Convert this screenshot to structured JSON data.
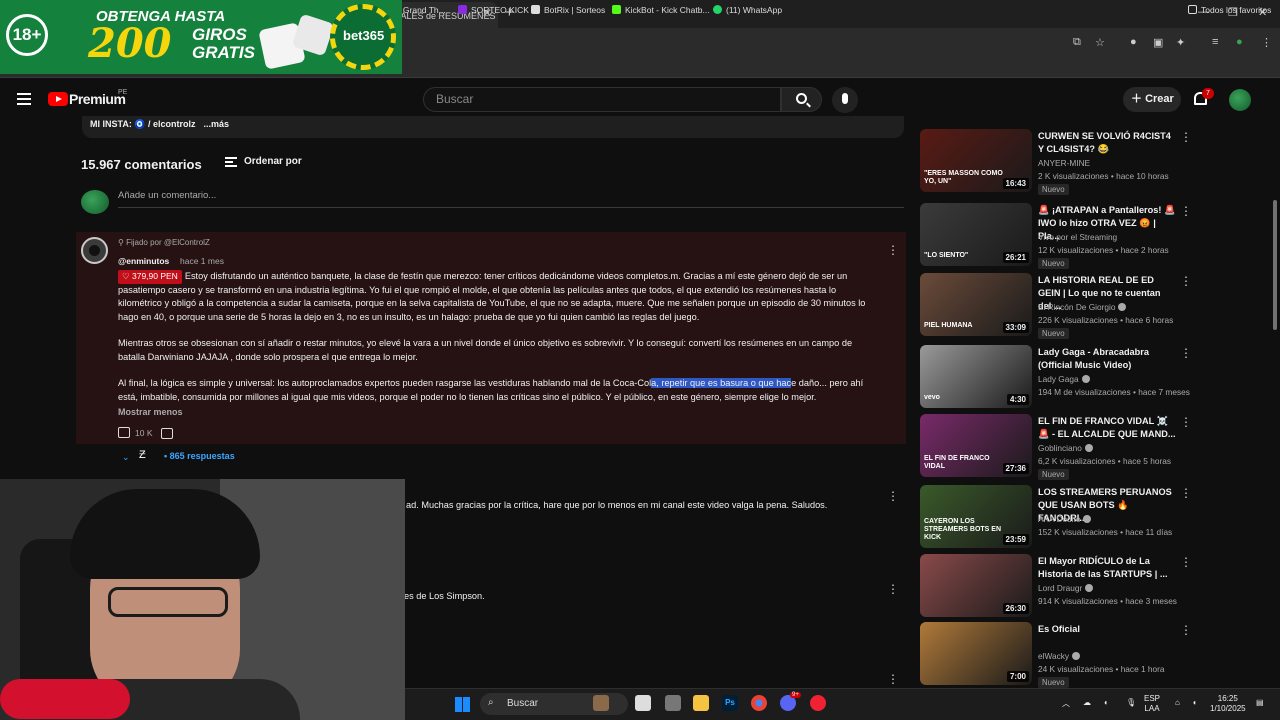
{
  "browser": {
    "tab_title": "ANALES de RESÚMENES",
    "bookmarks": [
      "e de Grand Th...",
      "SORTEO KICK",
      "BotRix | Sorteos",
      "KickBot - Kick Chatb...",
      "(11) WhatsApp"
    ],
    "all_favorites": "Todos los favoritos"
  },
  "ad": {
    "age": "18+",
    "line1": "OBTENGA HASTA",
    "amount": "200",
    "giros": "GIROS",
    "gratis": "GRATIS",
    "brand": "bet365"
  },
  "header": {
    "brand": "Premium",
    "region": "PE",
    "search_placeholder": "Buscar",
    "create_label": "Crear",
    "notif_count": "7"
  },
  "description": {
    "insta": "MI INSTA: 🧿 / elcontrolz",
    "more": "...más"
  },
  "comments": {
    "count": "15.967 comentarios",
    "sort_label": "Ordenar por",
    "add_placeholder": "Añade un comentario...",
    "pinned": {
      "pinned_by": "Fijado por @ElControlZ",
      "author": "@enminutos",
      "time": "hace 1 mes",
      "badge": "379,90 PEN",
      "p1": "Estoy disfrutando un auténtico banquete, la clase de festín que merezco: tener críticos dedicándome videos completos.m. Gracias a mí este género dejó de ser un pasatiempo casero y se transformó en una industria legítima. Yo fui el que rompió el molde, el que obtenía las películas antes que todos, el que extendió los resúmenes hasta lo kilométrico y obligó a la competencia a sudar la camiseta, porque en la selva capitalista de YouTube, el que no se adapta, muere. Que me señalen porque un episodio de 30 minutos lo hago en 40, o porque una serie de 5 horas la dejo en 3, no es un insulto, es un halago: prueba de que yo fui quien cambió las reglas del juego.",
      "p2": "Mientras otros se obsesionan con sí añadir o restar minutos, yo elevé la vara a un nivel donde el único objetivo es sobrevivir. Y lo conseguí: convertí los resúmenes en un campo de batalla Darwiniano JAJAJA , donde solo prospera el que entrega lo mejor.",
      "p3a": "Al final, la lógica es simple y universal: los autoproclamados expertos pueden rasgarse las vestiduras hablando mal de la Coca-Col",
      "p3hl": "a, repetir que es basura o que hac",
      "p3b": "e daño... pero ahí está, imbatible, consumida por millones al igual que mis videos, porque el poder no lo tienen las críticas sino el público. Y el público, en este género, siempre elige lo mejor.",
      "show_more": "Mostrar menos",
      "likes": "10 K",
      "replies": "• 865 respuestas"
    },
    "tail1": "ad. Muchas gracias por la crítica, hare que por lo menos en mi canal este video valga la pena. Saludos.",
    "tail2": "es de Los Simpson."
  },
  "sidebar": [
    {
      "title": "CURWEN SE VOLVIÓ R4CIST4 Y CL4SIST4? 😂",
      "channel": "ANYER-MINE",
      "stats": "2 K visualizaciones • hace 10 horas",
      "badge": "Nuevo",
      "duration": "16:43",
      "thumb_color": "#5a1a14"
    },
    {
      "title": "🚨 ¡ATRAPAN a Pantalleros! 🚨 IWO lo hizo OTRA VEZ 😡 | Pla...",
      "channel": "Vivo por el Streaming",
      "stats": "12 K visualizaciones • hace 2 horas",
      "badge": "Nuevo",
      "duration": "26:21",
      "thumb_color": "#3b3b3b"
    },
    {
      "title": "LA HISTORIA REAL DE ED GEIN | Lo que no te cuentan del ...",
      "channel": "El Rincón De Giorgio",
      "stats": "226 K visualizaciones • hace 6 horas",
      "badge": "Nuevo",
      "duration": "33:09",
      "thumb_color": "#6b4b3a"
    },
    {
      "title": "Lady Gaga - Abracadabra (Official Music Video)",
      "channel": "Lady Gaga",
      "stats": "194 M de visualizaciones • hace 7 meses",
      "badge": "",
      "duration": "4:30",
      "thumb_color": "#9a9a9a"
    },
    {
      "title": "EL FIN DE FRANCO VIDAL ☠️ 🚨 - EL ALCALDE QUE MAND...",
      "channel": "Goblinciano",
      "stats": "6,2 K visualizaciones • hace 5 horas",
      "badge": "Nuevo",
      "duration": "27:36",
      "thumb_color": "#7a2a6a"
    },
    {
      "title": "LOS STREAMERS PERUANOS QUE USAN BOTS 🔥 FANODRI...",
      "channel": "AKA Dodito",
      "stats": "152 K visualizaciones • hace 11 días",
      "badge": "",
      "duration": "23:59",
      "thumb_color": "#3a5a2a"
    },
    {
      "title": "El Mayor RIDÍCULO de La Historia de las STARTUPS | ...",
      "channel": "Lord Draugr",
      "stats": "914 K visualizaciones • hace 3 meses",
      "badge": "",
      "duration": "26:30",
      "thumb_color": "#8a4a4a"
    },
    {
      "title": "Es Oficial",
      "channel": "elWacky",
      "stats": "24 K visualizaciones • hace 1 hora",
      "badge": "Nuevo",
      "duration": "7:00",
      "thumb_color": "#b07a3a"
    }
  ],
  "sidebar_thumb_labels": [
    "\"ERES MASSON COMO YO, UN\"",
    "\"LO SIENTO\"",
    "PIEL HUMANA",
    "vevo",
    "EL FIN DE FRANCO VIDAL",
    "CAYERON LOS STREAMERS BOTS EN KICK"
  ],
  "taskbar": {
    "search": "Buscar",
    "lang1": "ESP",
    "lang2": "LAA",
    "time": "16:25",
    "date": "1/10/2025",
    "discord_badge": "9+"
  }
}
